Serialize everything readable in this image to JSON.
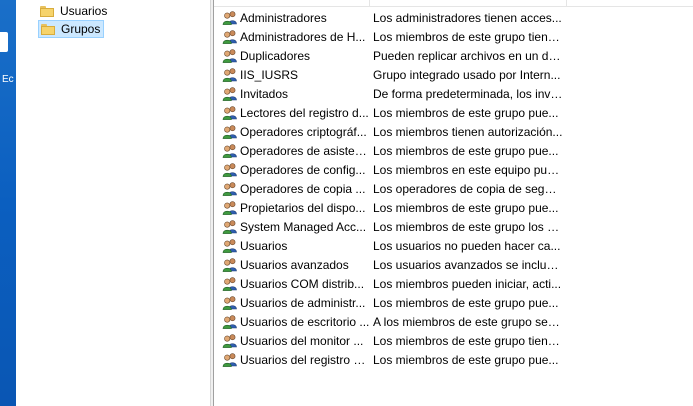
{
  "desktop": {
    "label": "Ec"
  },
  "tree": {
    "items": [
      {
        "label": "Usuarios",
        "icon": "folder-icon",
        "selected": false
      },
      {
        "label": "Grupos",
        "icon": "folder-icon",
        "selected": true
      }
    ]
  },
  "list": {
    "rows": [
      {
        "name": "Administradores",
        "description": "Los administradores tienen acces..."
      },
      {
        "name": "Administradores de H...",
        "description": "Los miembros de este grupo tiene..."
      },
      {
        "name": "Duplicadores",
        "description": "Pueden replicar archivos en un do..."
      },
      {
        "name": "IIS_IUSRS",
        "description": "Grupo integrado usado por Intern..."
      },
      {
        "name": "Invitados",
        "description": "De forma predeterminada, los invi..."
      },
      {
        "name": "Lectores del registro d...",
        "description": "Los miembros de este grupo pue..."
      },
      {
        "name": "Operadores criptográf...",
        "description": "Los miembros tienen autorización..."
      },
      {
        "name": "Operadores de asisten...",
        "description": "Los miembros de este grupo pue..."
      },
      {
        "name": "Operadores de config...",
        "description": "Los miembros en este equipo pue..."
      },
      {
        "name": "Operadores de copia ...",
        "description": "Los operadores de copia de seguri..."
      },
      {
        "name": "Propietarios del dispo...",
        "description": "Los miembros de este grupo pue..."
      },
      {
        "name": "System Managed Acc...",
        "description": "Los miembros de este grupo los a..."
      },
      {
        "name": "Usuarios",
        "description": "Los usuarios no pueden hacer ca..."
      },
      {
        "name": "Usuarios avanzados",
        "description": "Los usuarios avanzados se incluye..."
      },
      {
        "name": "Usuarios COM distrib...",
        "description": "Los miembros pueden iniciar, acti..."
      },
      {
        "name": "Usuarios de administr...",
        "description": "Los miembros de este grupo pue..."
      },
      {
        "name": "Usuarios de escritorio ...",
        "description": "A los miembros de este grupo se l..."
      },
      {
        "name": "Usuarios del monitor ...",
        "description": "Los miembros de este grupo tiene..."
      },
      {
        "name": "Usuarios del registro d...",
        "description": "Los miembros de este grupo pue..."
      }
    ],
    "row_icon": "group-users-icon"
  },
  "colors": {
    "selection_bg": "#cce8ff",
    "selection_border": "#99d1ff",
    "desktop_blue": "#0b5fc0"
  }
}
